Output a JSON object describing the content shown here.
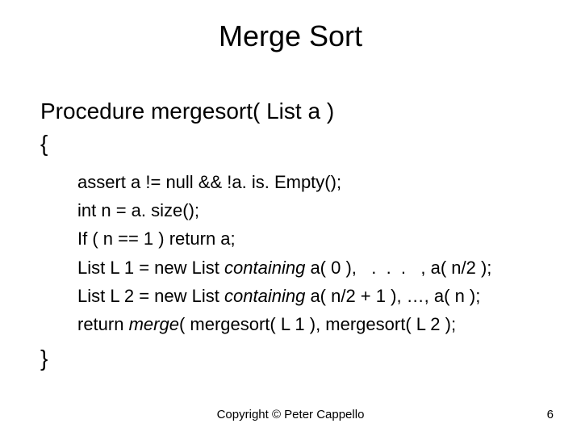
{
  "title": "Merge Sort",
  "proc": "Procedure mergesort( List a )",
  "brace_open": "{",
  "brace_close": "}",
  "lines": {
    "l0": "assert a != null && !a. is. Empty();",
    "l1": "int n = a. size();",
    "l2": "If ( n == 1 ) return a;",
    "l3a": "List L 1 = new List ",
    "l3b": "containing",
    "l3c": " a( 0 ),   .  .  .   , a( n/2 );",
    "l4a": "List L 2 = new List ",
    "l4b": "containing",
    "l4c": " a( n/2 + 1 ), …, a( n );",
    "l5a": "return ",
    "l5b": "merge",
    "l5c": "( mergesort( L 1 ), mergesort( L 2 );"
  },
  "copyright": "Copyright © Peter Cappello",
  "pagenum": "6"
}
